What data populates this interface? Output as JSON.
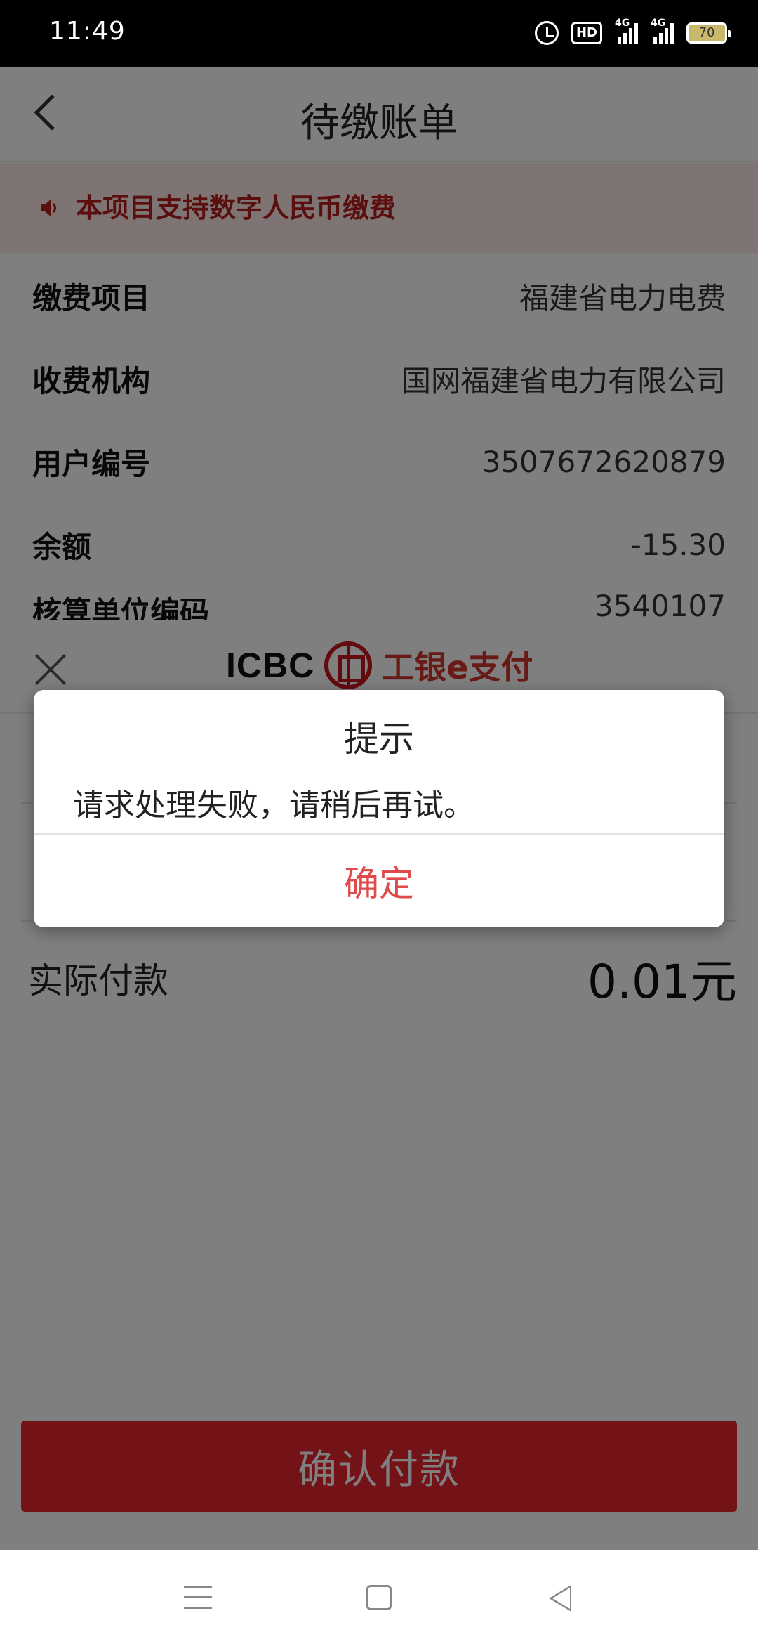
{
  "status_bar": {
    "time": "11:49",
    "hd_label": "HD",
    "sim1_label": "4G",
    "sim2_label": "4G",
    "battery": "70"
  },
  "header": {
    "title": "待缴账单"
  },
  "notice": {
    "text": "本项目支持数字人民币缴费",
    "color": "#b71c1c"
  },
  "bill_info": {
    "rows": [
      {
        "label": "缴费项目",
        "value": "福建省电力电费"
      },
      {
        "label": "收费机构",
        "value": "国网福建省电力有限公司"
      },
      {
        "label": "用户编号",
        "value": "3507672620879"
      },
      {
        "label": "余额",
        "value": "-15.30"
      }
    ],
    "partial_label": "核算单位编码",
    "partial_value": "3540107"
  },
  "payment_sheet": {
    "brand_text": "ICBC",
    "brand_pay": "工银e支付",
    "actual_payment_label": "实际付款",
    "actual_payment_amount": "0.01元",
    "confirm_button": "确认付款",
    "accent_color": "#e9262e"
  },
  "dialog": {
    "title": "提示",
    "message": "请求处理失败，请稍后再试。",
    "ok_button": "确定",
    "ok_color": "#e04a4a"
  },
  "nav_bar": {
    "icons": [
      "menu-icon",
      "home-icon",
      "back-icon"
    ]
  }
}
